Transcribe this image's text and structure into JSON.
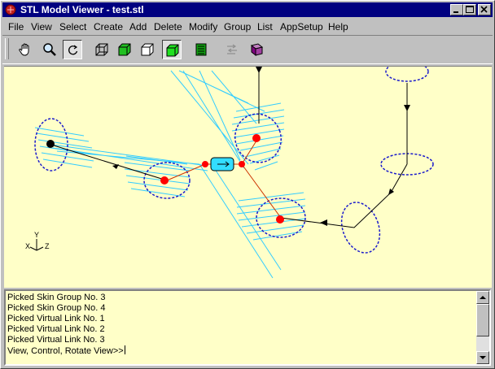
{
  "window": {
    "title": "STL Model Viewer - test.stl",
    "icon": "stl-app-icon",
    "caption_buttons": [
      "minimize-icon",
      "maximize-icon",
      "close-icon"
    ]
  },
  "menubar": {
    "items": [
      "File",
      "View",
      "Select",
      "Create",
      "Add",
      "Delete",
      "Modify",
      "Group",
      "List",
      "AppSetup",
      "Help"
    ]
  },
  "toolbar": {
    "buttons": [
      {
        "icon": "hand-pan-icon",
        "pressed": false
      },
      {
        "icon": "magnifier-zoom-icon",
        "pressed": false
      },
      {
        "icon": "rotate-icon",
        "pressed": true
      },
      {
        "icon": "wireframe-cube-icon",
        "pressed": false
      },
      {
        "icon": "green-cube-icon",
        "pressed": false
      },
      {
        "icon": "outline-cube-icon",
        "pressed": false
      },
      {
        "icon": "solid-green-cube-icon",
        "pressed": true
      },
      {
        "icon": "list-panel-icon",
        "pressed": false
      },
      {
        "icon": "arrows-icon",
        "pressed": false
      },
      {
        "icon": "book-icon",
        "pressed": false
      }
    ]
  },
  "viewport": {
    "background": "#ffffc8",
    "colors": {
      "skin": "#33ccff",
      "loop": "#1a1acc",
      "link": "#000000",
      "node": "#ff0000",
      "connector": "#cc3300",
      "selected_box": "#33ddff"
    },
    "axis_labels": {
      "x": "X",
      "y": "Y",
      "z": "Z"
    }
  },
  "console": {
    "lines": [
      "Picked Skin Group No. 3",
      "Picked Skin Group No. 4",
      "Picked Virtual Link No. 1",
      "Picked Virtual Link No. 2",
      "Picked Virtual Link No. 3"
    ],
    "prompt": "View, Control, Rotate View>>"
  }
}
